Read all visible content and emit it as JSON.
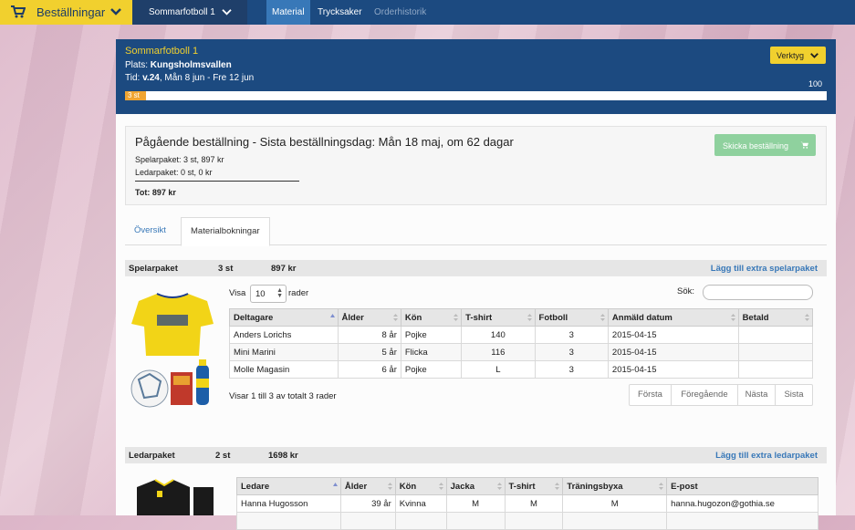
{
  "topnav": {
    "orders_label": "Beställningar",
    "event_label": "Sommarfotboll 1",
    "tabs": [
      {
        "label": "Material"
      },
      {
        "label": "Trycksaker"
      },
      {
        "label": "Orderhistorik"
      }
    ]
  },
  "event": {
    "title": "Sommarfotboll 1",
    "place_label": "Plats:",
    "place_value": "Kungsholmsvallen",
    "time_label": "Tid:",
    "time_week": "v.24",
    "time_range": ", Mån 8 jun - Fre 12 jun",
    "tools_label": "Verktyg",
    "capacity_max": "100",
    "progress_label": "3 st",
    "progress_fraction": 0.03
  },
  "order": {
    "title": "Pågående beställning - Sista beställningsdag: Mån 18 maj, om 62 dagar",
    "player_line": "Spelarpaket: 3 st, 897 kr",
    "leader_line": "Ledarpaket: 0 st, 0 kr",
    "total": "Tot: 897 kr",
    "send_label": "Skicka beställning"
  },
  "tabs": {
    "overview": "Översikt",
    "bookings": "Materialbokningar"
  },
  "player_pack": {
    "name": "Spelarpaket",
    "count": "3 st",
    "price": "897 kr",
    "add_label": "Lägg till extra spelarpaket",
    "show_label": "Visa",
    "show_value": "10",
    "rows_label": "rader",
    "search_label": "Sök:",
    "columns": [
      "Deltagare",
      "Ålder",
      "Kön",
      "T-shirt",
      "Fotboll",
      "Anmäld datum",
      "Betald"
    ],
    "rows": [
      [
        "Anders Lorichs",
        "8 år",
        "Pojke",
        "140",
        "3",
        "2015-04-15",
        ""
      ],
      [
        "Mini Marini",
        "5 år",
        "Flicka",
        "116",
        "3",
        "2015-04-15",
        ""
      ],
      [
        "Molle Magasin",
        "6 år",
        "Pojke",
        "L",
        "3",
        "2015-04-15",
        ""
      ]
    ],
    "info": "Visar 1 till 3 av totalt 3 rader",
    "pager": [
      "Första",
      "Föregående",
      "Nästa",
      "Sista"
    ]
  },
  "leader_pack": {
    "name": "Ledarpaket",
    "count": "2 st",
    "price": "1698 kr",
    "add_label": "Lägg till extra ledarpaket",
    "columns": [
      "Ledare",
      "Ålder",
      "Kön",
      "Jacka",
      "T-shirt",
      "Träningsbyxa",
      "E-post"
    ],
    "rows": [
      [
        "Hanna Hugosson",
        "39 år",
        "Kvinna",
        "M",
        "M",
        "M",
        "hanna.hugozon@gothia.se"
      ]
    ]
  },
  "colors": {
    "navy": "#1c4a80",
    "yellow": "#f1d02e",
    "link_blue": "#3878b8",
    "progress_orange": "#f0a532",
    "send_green": "#8fd19e"
  },
  "icons": [
    "cart-icon",
    "chevron-down-icon",
    "sort-icon",
    "tshirt-image",
    "football-image",
    "jacket-image"
  ]
}
